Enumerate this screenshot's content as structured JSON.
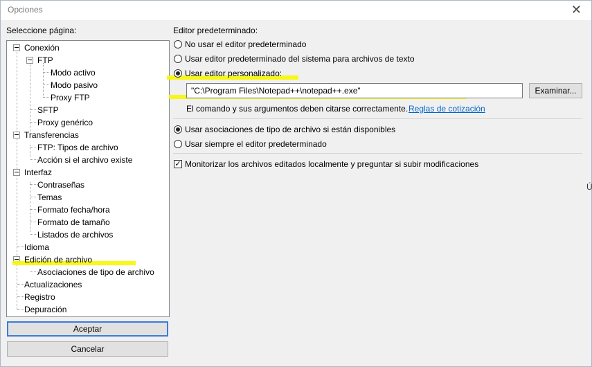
{
  "window": {
    "title": "Opciones",
    "close_glyph": "✕"
  },
  "page_select_label": "Seleccione página:",
  "tree": [
    {
      "label": "Conexión",
      "level": 0
    },
    {
      "label": "FTP",
      "level": 1
    },
    {
      "label": "Modo activo",
      "level": 2
    },
    {
      "label": "Modo pasivo",
      "level": 2
    },
    {
      "label": "Proxy FTP",
      "level": 2
    },
    {
      "label": "SFTP",
      "level": 1
    },
    {
      "label": "Proxy genérico",
      "level": 1
    },
    {
      "label": "Transferencias",
      "level": 0
    },
    {
      "label": "FTP: Tipos de archivo",
      "level": 1
    },
    {
      "label": "Acción si el archivo existe",
      "level": 1
    },
    {
      "label": "Interfaz",
      "level": 0
    },
    {
      "label": "Contraseñas",
      "level": 1
    },
    {
      "label": "Temas",
      "level": 1
    },
    {
      "label": "Formato fecha/hora",
      "level": 1
    },
    {
      "label": "Formato de tamaño",
      "level": 1
    },
    {
      "label": "Listados de archivos",
      "level": 1
    },
    {
      "label": "Idioma",
      "level": 0
    },
    {
      "label": "Edición de archivo",
      "level": 0
    },
    {
      "label": "Asociaciones de tipo de archivo",
      "level": 1
    },
    {
      "label": "Actualizaciones",
      "level": 0
    },
    {
      "label": "Registro",
      "level": 0
    },
    {
      "label": "Depuración",
      "level": 0
    }
  ],
  "buttons": {
    "ok": "Aceptar",
    "cancel": "Cancelar",
    "browse": "Examinar..."
  },
  "editor": {
    "section_label": "Editor predeterminado:",
    "options": [
      {
        "label": "No usar el editor predeterminado",
        "selected": false
      },
      {
        "label": "Usar editor predeterminado del sistema para archivos de texto",
        "selected": false
      },
      {
        "label": "Usar editor personalizado:",
        "selected": true
      }
    ],
    "custom_path": "\"C:\\Program Files\\Notepad++\\notepad++.exe\"",
    "quote_note": "El comando y sus argumentos deben citarse correctamente.",
    "quote_link": "Reglas de cotización"
  },
  "association": {
    "options": [
      {
        "label": "Usar asociaciones de tipo de archivo si están disponibles",
        "selected": true
      },
      {
        "label": "Usar siempre el editor predeterminado",
        "selected": false
      }
    ]
  },
  "monitor": {
    "label": "Monitorizar los archivos editados localmente y preguntar si subir modificaciones",
    "checked": true
  },
  "background_fragment": "Ú",
  "colors": {
    "highlight": "#f7f700",
    "link": "#0066cc",
    "focus": "#3d7bd8"
  }
}
